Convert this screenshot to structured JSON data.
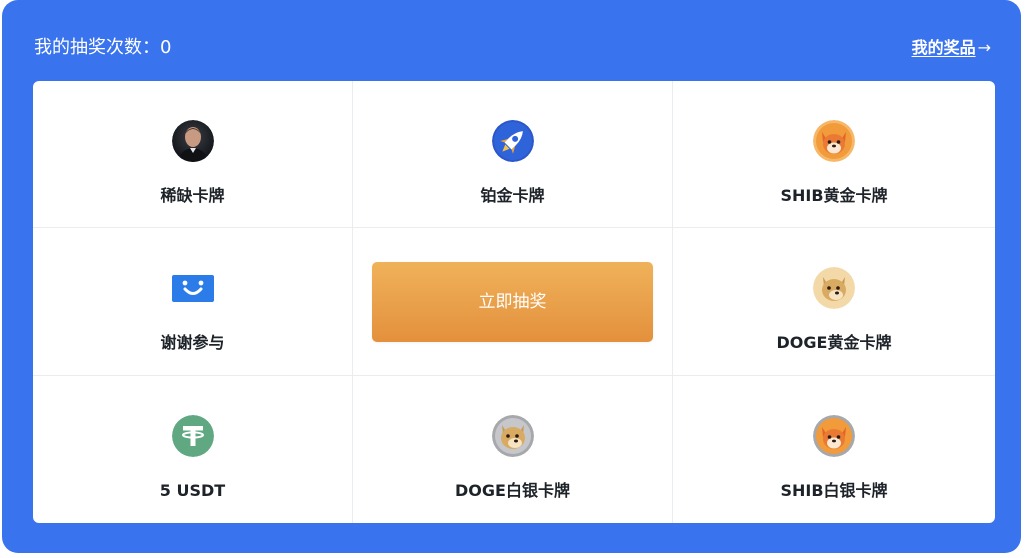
{
  "header": {
    "draw_count": "我的抽奖次数：0",
    "my_prizes_link": "我的奖品",
    "arrow": "→"
  },
  "prizes": [
    {
      "label": "稀缺卡牌",
      "icon": "portrait-avatar-icon"
    },
    {
      "label": "铂金卡牌",
      "icon": "rocket-icon"
    },
    {
      "label": "SHIB黄金卡牌",
      "icon": "shiba-inu-icon"
    },
    {
      "label": "谢谢参与",
      "icon": "smile-box-icon"
    },
    {
      "label": "DOGE黄金卡牌",
      "icon": "doge-icon"
    },
    {
      "label": "5 USDT",
      "icon": "tether-icon"
    },
    {
      "label": "DOGE白银卡牌",
      "icon": "doge-silver-icon"
    },
    {
      "label": "SHIB白银卡牌",
      "icon": "shiba-inu-silver-icon"
    }
  ],
  "draw_button": {
    "label": "立即抽奖"
  },
  "colors": {
    "panel": "#3a73ee",
    "button_top": "#efb25a",
    "button_bottom": "#e4903c",
    "text_dark": "#1e2329",
    "tether": "#5fa882"
  }
}
